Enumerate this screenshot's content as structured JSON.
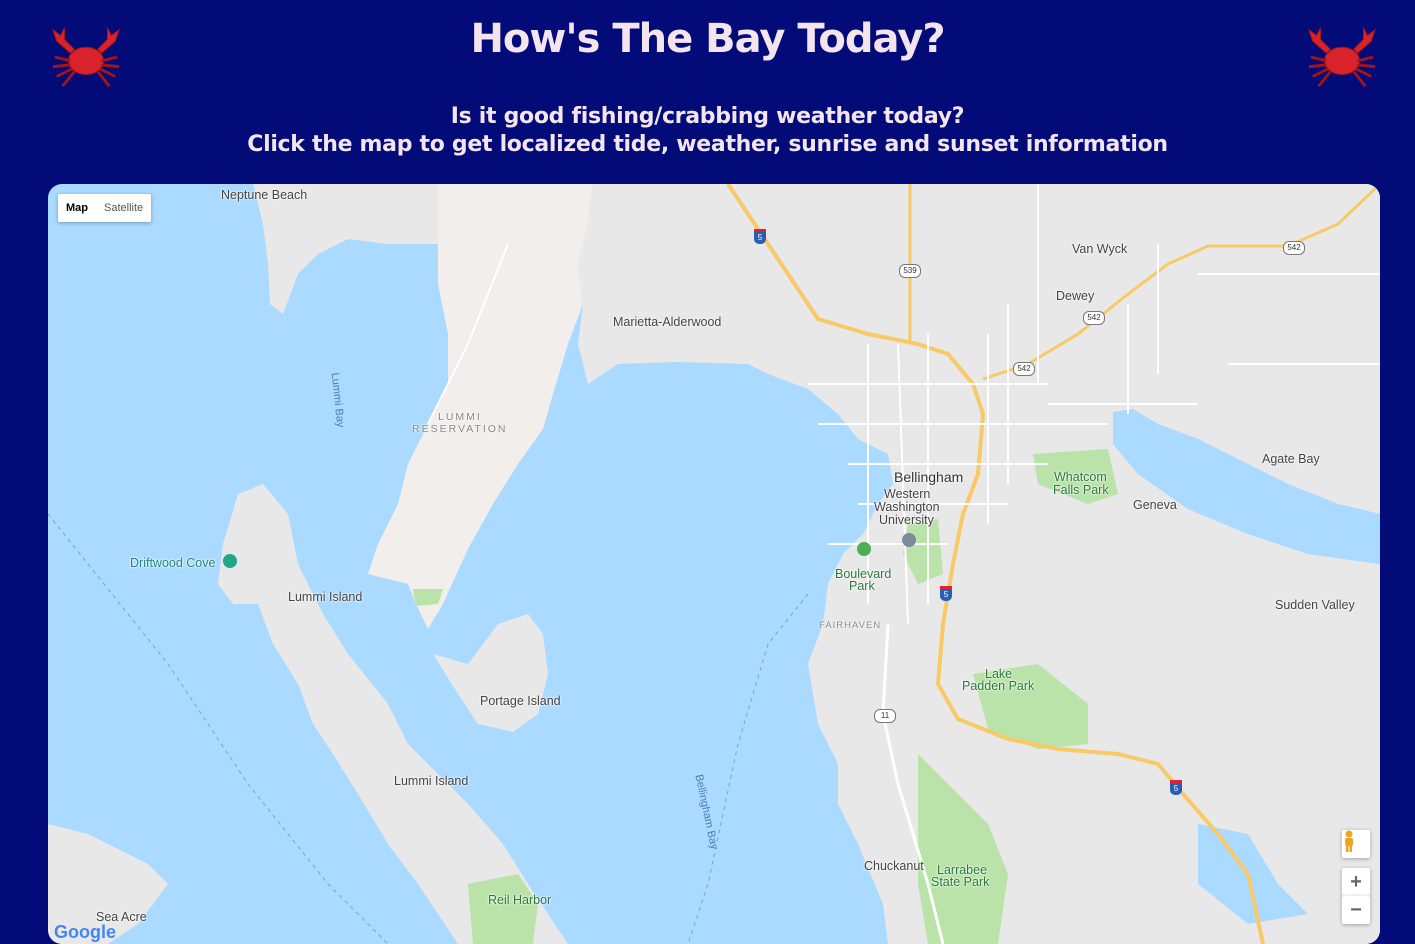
{
  "header": {
    "title": "How's The Bay Today?",
    "subtitle_line1": "Is it good fishing/crabbing weather today?",
    "subtitle_line2": "Click the map to get localized tide, weather, sunrise and sunset information"
  },
  "map": {
    "map_type_buttons": {
      "map": "Map",
      "satellite": "Satellite"
    },
    "zoom_in": "+",
    "zoom_out": "−",
    "attribution": "Google",
    "labels": {
      "neptune_beach": "Neptune Beach",
      "marietta": "Marietta-Alderwood",
      "van_wyck": "Van Wyck",
      "dewey": "Dewey",
      "lummi_bay": "Lummi Bay",
      "lummi_reservation_1": "LUMMI",
      "lummi_reservation_2": "RESERVATION",
      "bellingham": "Bellingham",
      "wwu_1": "Western",
      "wwu_2": "Washington",
      "wwu_3": "University",
      "whatcom_1": "Whatcom",
      "whatcom_2": "Falls Park",
      "agate_bay": "Agate Bay",
      "geneva": "Geneva",
      "driftwood_cove": "Driftwood Cove",
      "lummi_island_1": "Lummi Island",
      "boulevard_1": "Boulevard",
      "boulevard_2": "Park",
      "sudden_valley": "Sudden Valley",
      "fairhaven": "FAIRHAVEN",
      "lake_padden_1": "Lake",
      "lake_padden_2": "Padden Park",
      "portage_island": "Portage Island",
      "lummi_island_2": "Lummi Island",
      "bellingham_bay": "Bellingham Bay",
      "chuckanut": "Chuckanut",
      "larrabee_1": "Larrabee",
      "larrabee_2": "State Park",
      "reil_harbor": "Reil Harbor",
      "sea_acre": "Sea Acre"
    },
    "shields": {
      "i5_north": "5",
      "sr539": "539",
      "sr542_east": "542",
      "sr542_mid": "542",
      "sr542_west": "542",
      "i5_mid": "5",
      "sr11": "11",
      "i5_south": "5"
    }
  },
  "colors": {
    "background": "#020b78",
    "title": "#f3e4ee",
    "water": "#aadaff",
    "land": "#e8e8e8",
    "park": "#b9e3a8",
    "highway": "#f8c967"
  }
}
